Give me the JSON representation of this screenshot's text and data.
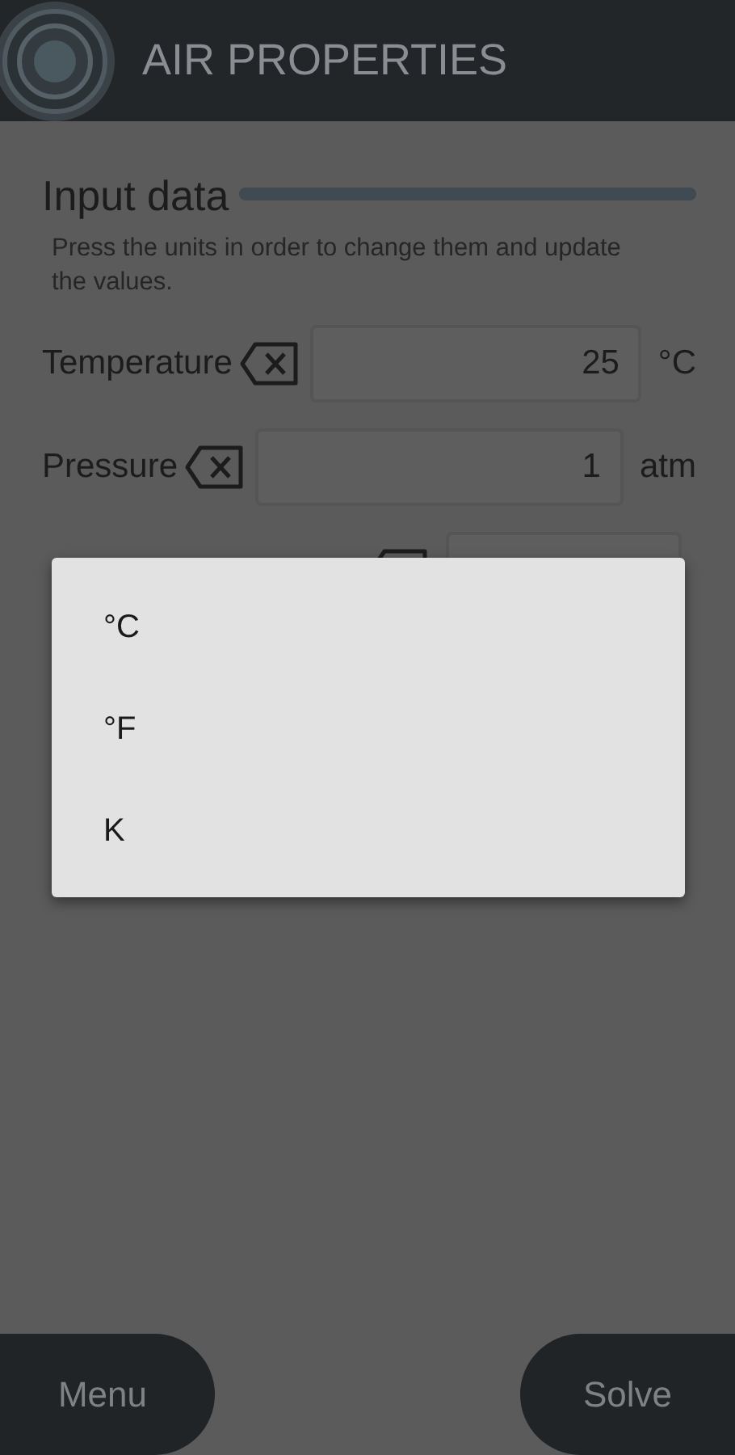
{
  "app_bar": {
    "title": "AIR PROPERTIES"
  },
  "input_section": {
    "heading": "Input data",
    "hint": "Press the units in order to change them and update the values.",
    "rows": [
      {
        "label": "Temperature",
        "value": "25",
        "unit": "°C"
      },
      {
        "label": "Pressure",
        "value": "1",
        "unit": "atm"
      },
      {
        "kind": "covered"
      }
    ]
  },
  "unit_menu": {
    "items": [
      "°C",
      "°F",
      "K"
    ]
  },
  "buttons": {
    "left": "Menu",
    "right": "Solve"
  }
}
